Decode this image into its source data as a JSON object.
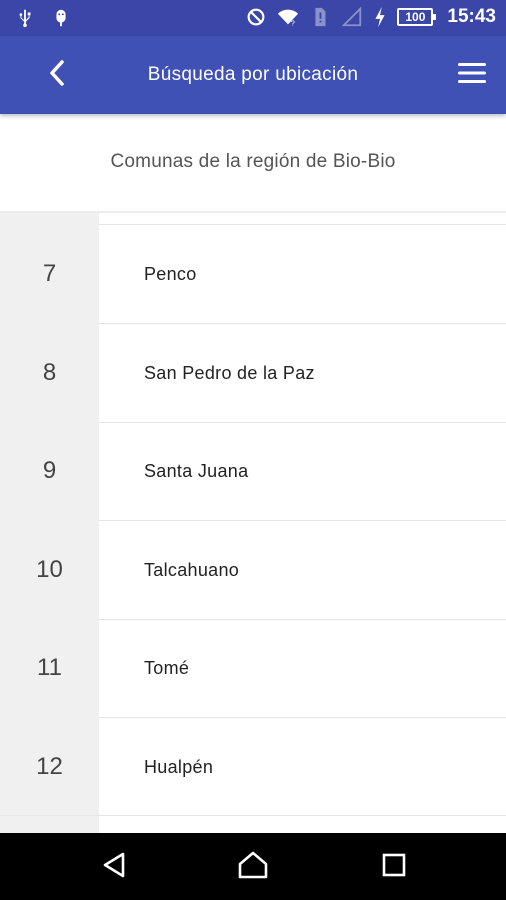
{
  "status_bar": {
    "time": "15:43",
    "battery": "100",
    "icons": [
      "usb-icon",
      "android-debug-icon",
      "do-not-disturb-icon",
      "wifi-icon",
      "sim-alert-icon",
      "signal-icon",
      "charging-icon",
      "battery-icon"
    ]
  },
  "app_bar": {
    "title": "Búsqueda por ubicación",
    "back_icon": "chevron-left-icon",
    "menu_icon": "hamburger-menu-icon",
    "accent": "#3f51b5"
  },
  "subtitle": "Comunas de la región de Bio-Bio",
  "list": {
    "items": [
      {
        "number": "7",
        "name": "Penco"
      },
      {
        "number": "8",
        "name": "San Pedro de la Paz"
      },
      {
        "number": "9",
        "name": "Santa Juana"
      },
      {
        "number": "10",
        "name": "Talcahuano"
      },
      {
        "number": "11",
        "name": "Tomé"
      },
      {
        "number": "12",
        "name": "Hualpén"
      }
    ]
  },
  "nav_bar": {
    "icons": [
      "back-triangle-icon",
      "home-icon",
      "recents-square-icon"
    ]
  }
}
